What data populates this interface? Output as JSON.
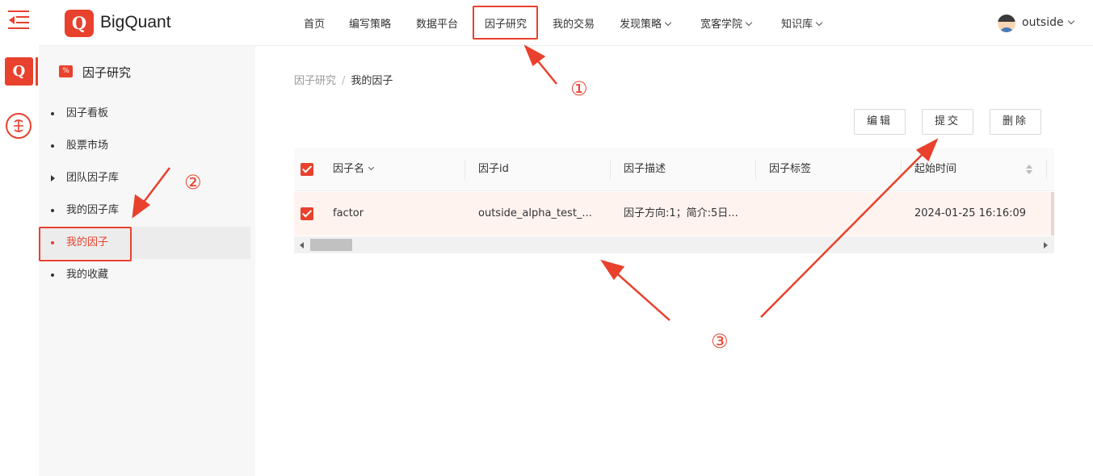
{
  "brand": {
    "name": "BigQuant",
    "logo_letter": "Q"
  },
  "rail": {
    "q_letter": "Q"
  },
  "nav": {
    "items": [
      {
        "label": "首页",
        "dropdown": false
      },
      {
        "label": "编写策略",
        "dropdown": false
      },
      {
        "label": "数据平台",
        "dropdown": false
      },
      {
        "label": "因子研究",
        "dropdown": false,
        "active": true
      },
      {
        "label": "我的交易",
        "dropdown": false
      },
      {
        "label": "发现策略",
        "dropdown": true
      },
      {
        "label": "宽客学院",
        "dropdown": true
      },
      {
        "label": "知识库",
        "dropdown": true
      }
    ],
    "user": "outside"
  },
  "sidebar": {
    "title": "因子研究",
    "title_icon": "%",
    "items": [
      {
        "label": "因子看板",
        "marker": "dot"
      },
      {
        "label": "股票市场",
        "marker": "dot"
      },
      {
        "label": "团队因子库",
        "marker": "triangle"
      },
      {
        "label": "我的因子库",
        "marker": "dot"
      },
      {
        "label": "我的因子",
        "marker": "dot",
        "active": true
      },
      {
        "label": "我的收藏",
        "marker": "dot"
      }
    ]
  },
  "breadcrumb": {
    "parent": "因子研究",
    "separator": "/",
    "current": "我的因子"
  },
  "toolbar": {
    "edit": "编辑",
    "submit": "提交",
    "delete": "删除"
  },
  "table": {
    "columns": [
      "因子名",
      "因子id",
      "因子描述",
      "因子标签",
      "起始时间"
    ],
    "rows": [
      {
        "name": "factor",
        "id": "outside_alpha_test_...",
        "desc": "因子方向:1；简介:5日...",
        "tag": "",
        "start": "2024-01-25 16:16:09",
        "checked": true
      }
    ]
  },
  "annotations": {
    "one": "①",
    "two": "②",
    "three": "③"
  },
  "colors": {
    "accent": "#e8412d"
  }
}
